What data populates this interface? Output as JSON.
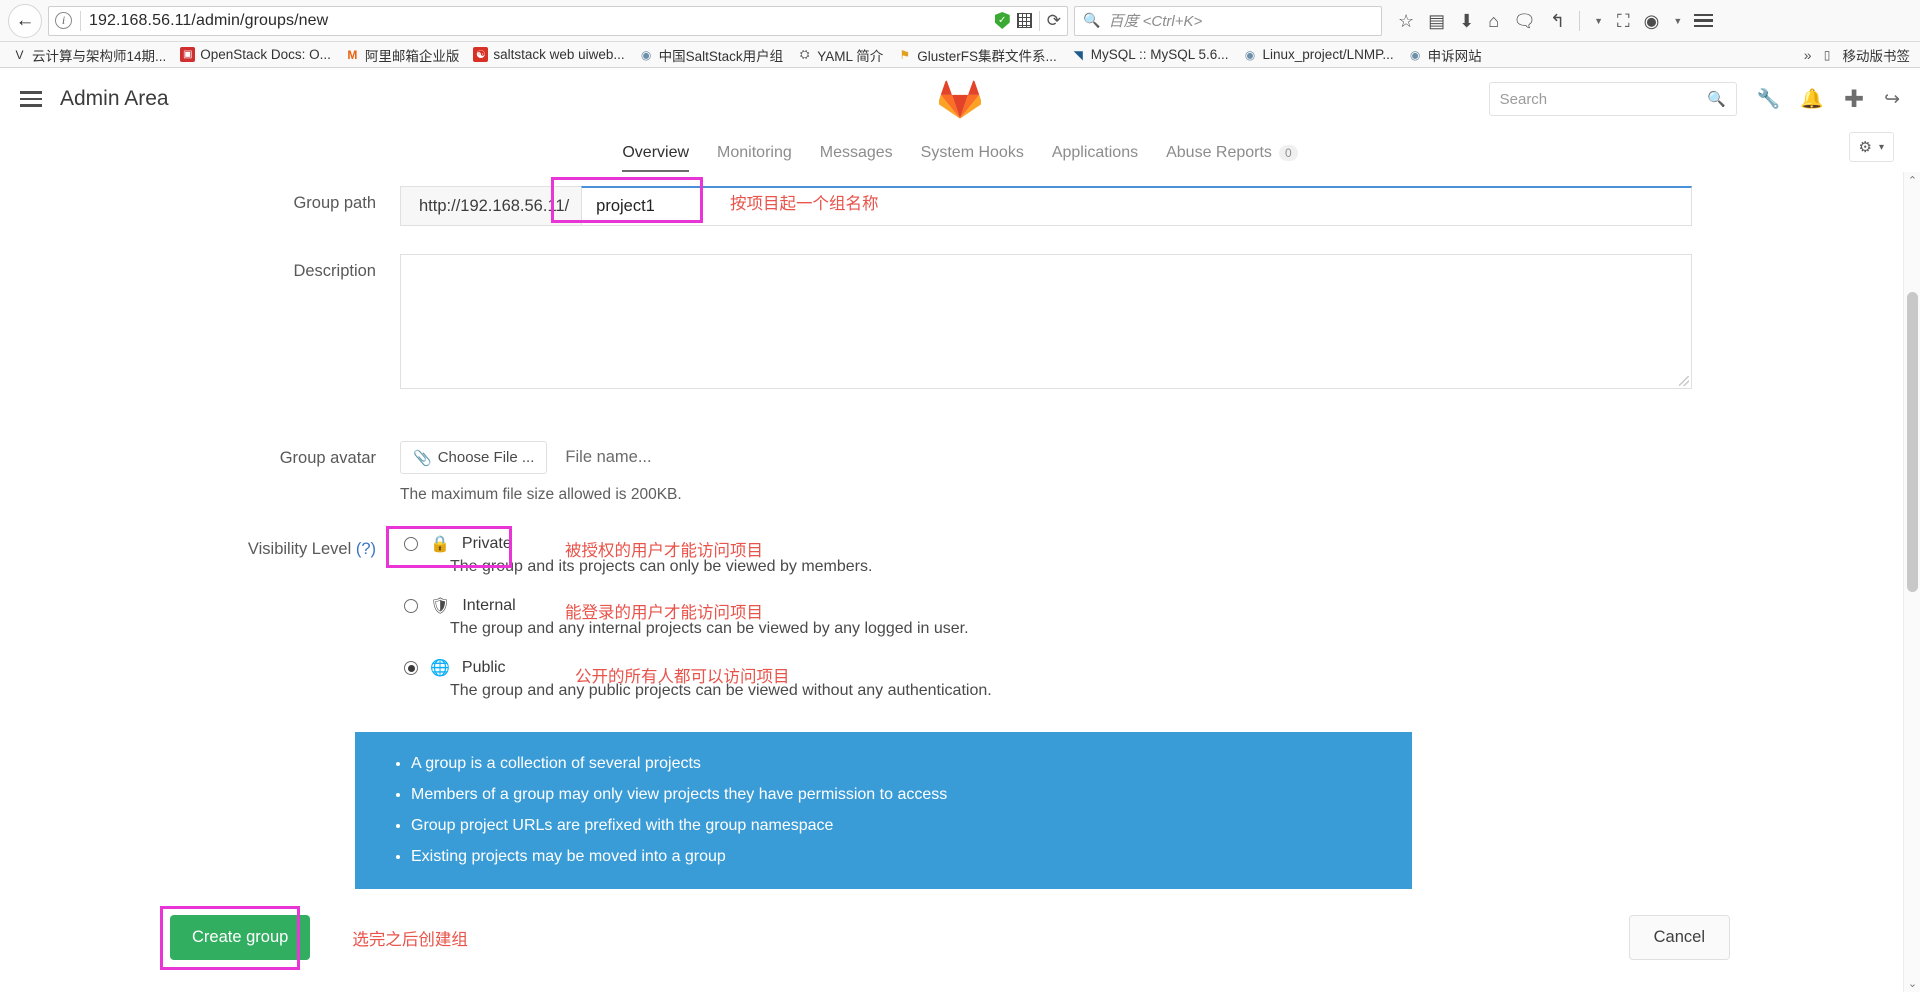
{
  "browser": {
    "url": "192.168.56.11/admin/groups/new",
    "search_placeholder": "百度 <Ctrl+K>",
    "back_icon": "back-arrow-icon",
    "info_icon": "page-info-icon",
    "reload_icon": "reload-icon",
    "toolbar_icons": [
      "star-icon",
      "library-icon",
      "downloads-icon",
      "home-icon",
      "pocket-icon",
      "undo-icon",
      "screenshot-icon",
      "account-icon"
    ],
    "menu_icon": "browser-menu-icon",
    "bookmarks": [
      {
        "label": "云计算与架构师14期...",
        "icon": "V",
        "color": "#333333"
      },
      {
        "label": "OpenStack Docs: O...",
        "icon": "▣",
        "color": "#cf2f2f"
      },
      {
        "label": "阿里邮箱企业版",
        "icon": "M",
        "color": "#e8620f"
      },
      {
        "label": "saltstack web uiweb...",
        "icon": "☯",
        "color": "#d93025"
      },
      {
        "label": "中国SaltStack用户组",
        "icon": "◉",
        "color": "#6d8fa8"
      },
      {
        "label": "YAML 简介",
        "icon": "⛭",
        "color": "#5a5a5a"
      },
      {
        "label": "GlusterFS集群文件系...",
        "icon": "⚑",
        "color": "#e0a020"
      },
      {
        "label": "MySQL :: MySQL 5.6...",
        "icon": "◥",
        "color": "#1f5c8b"
      },
      {
        "label": "Linux_project/LNMP...",
        "icon": "◉",
        "color": "#6d8fa8"
      },
      {
        "label": "申诉网站",
        "icon": "◉",
        "color": "#6d8fa8"
      }
    ],
    "overflow_label": "»",
    "mobile_bookmarks": "移动版书签"
  },
  "gitlab": {
    "title": "Admin Area",
    "menu_icon": "hamburger-menu-icon",
    "logo_icon": "gitlab-logo-icon",
    "search_placeholder": "Search",
    "header_icons": [
      "wrench-icon",
      "bell-icon",
      "plus-icon",
      "sign-out-icon"
    ],
    "tabs": [
      {
        "label": "Overview",
        "active": true
      },
      {
        "label": "Monitoring",
        "active": false
      },
      {
        "label": "Messages",
        "active": false
      },
      {
        "label": "System Hooks",
        "active": false
      },
      {
        "label": "Applications",
        "active": false
      },
      {
        "label": "Abuse Reports",
        "active": false,
        "badge": "0"
      }
    ],
    "settings_dropdown": {
      "icon": "gear-icon",
      "caret": "▾"
    }
  },
  "form": {
    "group_path": {
      "label": "Group path",
      "prefix": "http://192.168.56.11/",
      "value": "project1",
      "annotation": "按项目起一个组名称"
    },
    "description": {
      "label": "Description",
      "value": "",
      "placeholder": ""
    },
    "avatar": {
      "label": "Group avatar",
      "choose_button": "Choose File ...",
      "choose_icon": "paperclip-icon",
      "file_name": "File name...",
      "help": "The maximum file size allowed is 200KB."
    },
    "visibility": {
      "label": "Visibility Level",
      "help_link": "(?)",
      "options": [
        {
          "name": "Private",
          "icon": "lock-icon",
          "glyph": "🔒",
          "selected": false,
          "description": "The group and its projects can only be viewed by members.",
          "annotation": "被授权的用户才能访问项目"
        },
        {
          "name": "Internal",
          "icon": "shield-icon",
          "glyph": "🛡",
          "selected": false,
          "description": "The group and any internal projects can be viewed by any logged in user.",
          "annotation": "能登录的用户才能访问项目"
        },
        {
          "name": "Public",
          "icon": "globe-icon",
          "glyph": "🌐",
          "selected": true,
          "description": "The group and any public projects can be viewed without any authentication.",
          "annotation": "公开的所有人都可以访问项目"
        }
      ]
    },
    "info_list": [
      "A group is a collection of several projects",
      "Members of a group may only view projects they have permission to access",
      "Group project URLs are prefixed with the group namespace",
      "Existing projects may be moved into a group"
    ],
    "create_button": "Create group",
    "create_annotation": "选完之后创建组",
    "cancel_button": "Cancel"
  },
  "colors": {
    "highlight": "#e935d5",
    "annotation": "#e8534a",
    "info_box": "#3a9cd6",
    "create_button": "#31ae60"
  }
}
